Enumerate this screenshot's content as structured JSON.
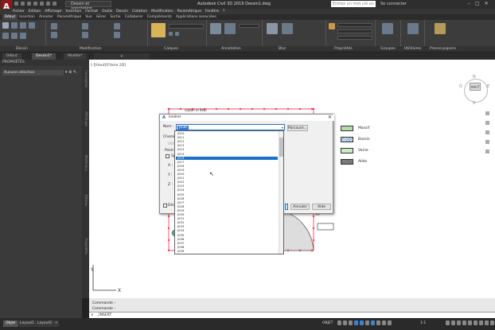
{
  "titlebar": {
    "workspace": "Dessin et annotation",
    "title": "Autodesk Civil 3D 2019   Dessin1.dwg",
    "search_placeholder": "Entrez un mot clé ou une expression",
    "user": "Se connecter"
  },
  "menubar": [
    "Fichier",
    "Edition",
    "Affichage",
    "Insertion",
    "Format",
    "Outils",
    "Dessin",
    "Cotation",
    "Modification",
    "Paramétrique",
    "Fenêtre",
    "?"
  ],
  "ribbon_tabs": [
    "Début",
    "Insertion",
    "Annoter",
    "Paramétrique",
    "Vue",
    "Gérer",
    "Sortie",
    "Collaborer",
    "Compléments",
    "Applications associées"
  ],
  "ribbon_panels": [
    "Dessin",
    "Modification",
    "Calques",
    "Annotation",
    "Bloc",
    "Propriétés",
    "Groupes",
    "Utilitaires",
    "Presse-papiers"
  ],
  "doc_tabs": [
    "Début",
    "Dessin1*",
    "Modèle*"
  ],
  "properties": {
    "header": "PROPRIÉTÉS",
    "selection": "Aucune sélection"
  },
  "side_tabs": [
    "Conception",
    "Affichage",
    "Matériaux",
    "Réseau",
    "Propriétés"
  ],
  "viewport_label": "[-][Haut][Filaire 2D]",
  "viewcube": {
    "face": "HAUT",
    "N": "N",
    "S": "S",
    "W": "O",
    "E": "E"
  },
  "legend": [
    {
      "label": "Massif",
      "color": "#b5dcb0",
      "hatch": "none"
    },
    {
      "label": "Bassin",
      "color": "#cfe2f3",
      "hatch": "diag"
    },
    {
      "label": "Voirie",
      "color": "#c9ecc5",
      "hatch": "grid"
    },
    {
      "label": "Allée",
      "color": "#777777",
      "hatch": "dots"
    }
  ],
  "drawing_label": "Gazon ni fleur",
  "dialog": {
    "title": "Insérer",
    "name_label": "Nom :",
    "name_value": "J030",
    "browse": "Parcourir...",
    "path_label": "Chemin :",
    "use_label": "Utilis",
    "insert_point": "Point d'inse",
    "specify_label": "Spéc",
    "x": "X :",
    "y": "Y :",
    "z": "Z :",
    "decompose": "Décompo",
    "ok": "OK",
    "cancel": "Annuler",
    "help": "Aide",
    "items": [
      "J010",
      "J011",
      "J012",
      "J013",
      "J014",
      "J015",
      "J016",
      "J017",
      "J018",
      "J019",
      "J020",
      "J021",
      "J022",
      "J023",
      "J024",
      "J025",
      "J026",
      "J027",
      "J028",
      "J029",
      "J030",
      "J031",
      "J032",
      "J033",
      "J034",
      "J035",
      "J036",
      "J037",
      "J038",
      "J039"
    ],
    "highlighted": "J016"
  },
  "command": {
    "line1": "Commande :",
    "line2": "Commande :",
    "prompt": "_INSERT"
  },
  "status": {
    "tabs": [
      "Objet",
      "Layout1",
      "Layout2"
    ],
    "coords": "OBJET",
    "scale": "1:1"
  }
}
